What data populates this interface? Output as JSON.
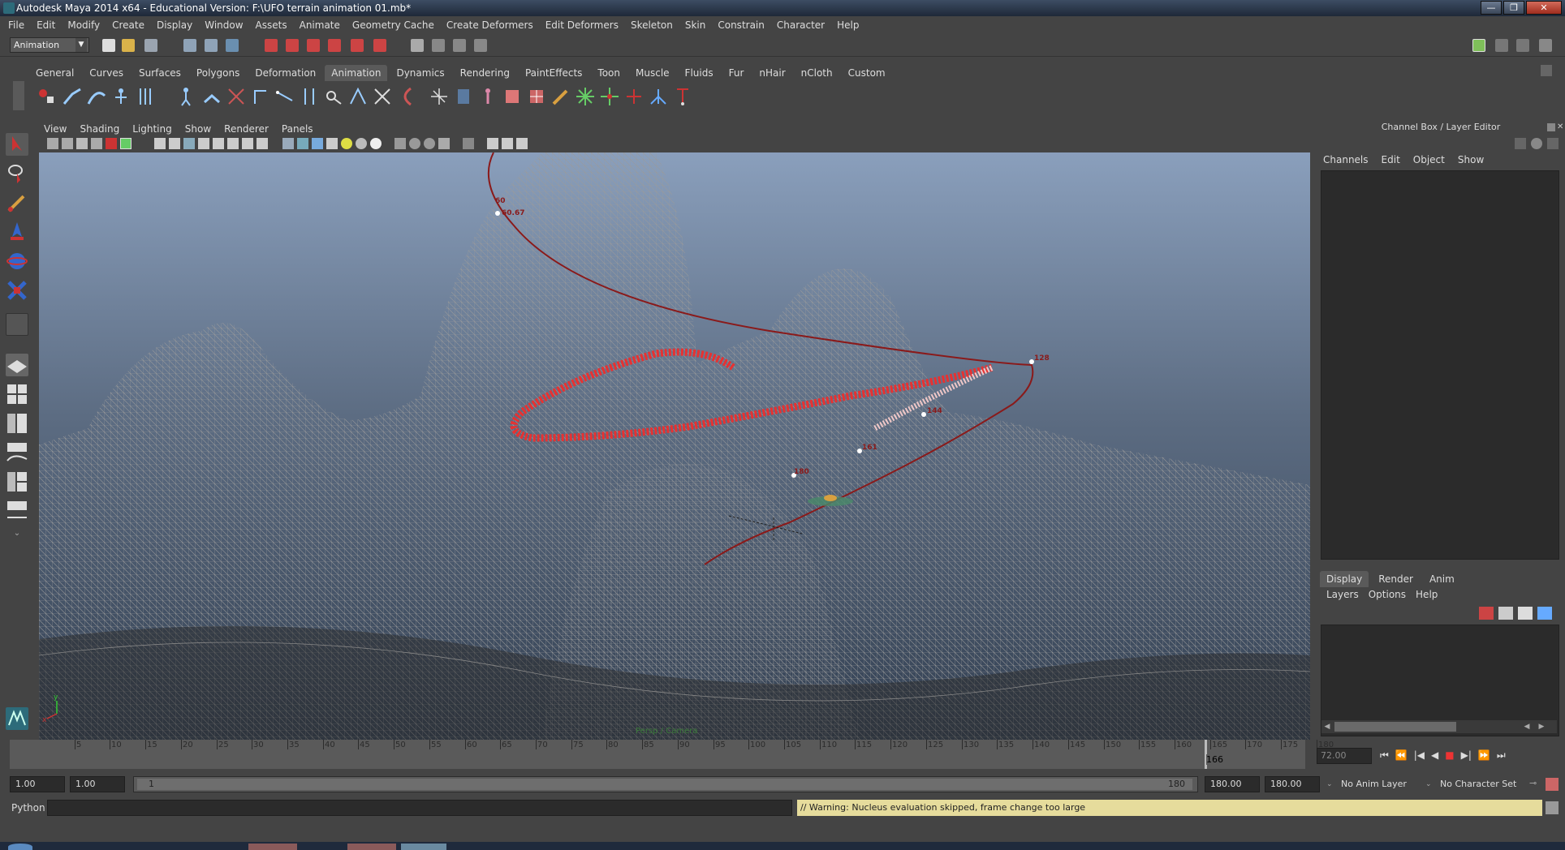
{
  "window": {
    "title": "Autodesk Maya 2014 x64 - Educational Version: F:\\UFO terrain animation 01.mb*",
    "min": "—",
    "max": "❐",
    "close": "✕"
  },
  "menu": [
    "File",
    "Edit",
    "Modify",
    "Create",
    "Display",
    "Window",
    "Assets",
    "Animate",
    "Geometry Cache",
    "Create Deformers",
    "Edit Deformers",
    "Skeleton",
    "Skin",
    "Constrain",
    "Character",
    "Help"
  ],
  "status": {
    "mode": "Animation"
  },
  "shelf": {
    "tabs": [
      "General",
      "Curves",
      "Surfaces",
      "Polygons",
      "Deformation",
      "Animation",
      "Dynamics",
      "Rendering",
      "PaintEffects",
      "Toon",
      "Muscle",
      "Fluids",
      "Fur",
      "nHair",
      "nCloth",
      "Custom"
    ],
    "active": "Animation"
  },
  "viewport": {
    "menu": [
      "View",
      "Shading",
      "Lighting",
      "Show",
      "Renderer",
      "Panels"
    ],
    "labels": {
      "k60": "60",
      "k60b": "60.67",
      "k128": "128",
      "k144": "144",
      "k161": "161",
      "k180": "180"
    },
    "axis_y": "y",
    "axis_x": "x",
    "camera_label": "Persp / Camera"
  },
  "channel_box": {
    "title": "Channel Box / Layer Editor",
    "menu": [
      "Channels",
      "Edit",
      "Object",
      "Show"
    ],
    "layer_tabs": [
      "Display",
      "Render",
      "Anim"
    ],
    "layer_menu": [
      "Layers",
      "Options",
      "Help"
    ]
  },
  "timeline": {
    "ticks": [
      "5",
      "10",
      "15",
      "20",
      "25",
      "30",
      "35",
      "40",
      "45",
      "50",
      "55",
      "60",
      "65",
      "70",
      "75",
      "80",
      "85",
      "90",
      "95",
      "100",
      "105",
      "110",
      "115",
      "120",
      "125",
      "130",
      "135",
      "140",
      "145",
      "150",
      "155",
      "160",
      "165",
      "170",
      "175",
      "180"
    ],
    "current_frame": "166",
    "current_time_field": "72.00"
  },
  "range": {
    "start": "1.00",
    "playback_start": "1.00",
    "slider_start": "1",
    "slider_end": "180",
    "playback_end": "180.00",
    "end": "180.00",
    "anim_layer": "No Anim Layer",
    "character_set": "No Character Set"
  },
  "command": {
    "language": "Python",
    "warning": "// Warning: Nucleus evaluation skipped, frame change too large"
  }
}
